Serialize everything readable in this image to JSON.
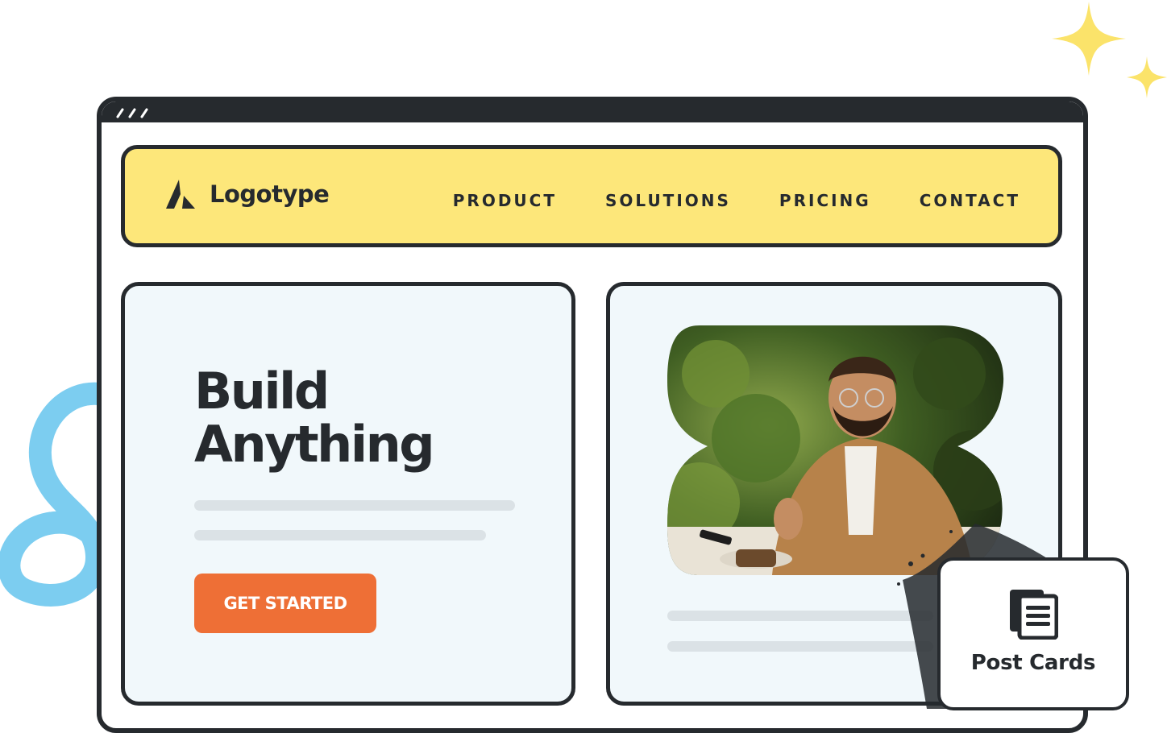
{
  "header": {
    "logo_text": "Logotype",
    "nav": [
      "PRODUCT",
      "SOLUTIONS",
      "PRICING",
      "CONTACT"
    ]
  },
  "hero": {
    "title_line1": "Build",
    "title_line2": "Anything",
    "cta_label": "GET STARTED"
  },
  "widget": {
    "label": "Post Cards",
    "icon": "document-stack-icon"
  },
  "colors": {
    "header_bg": "#fde77a",
    "cta": "#ee6f36",
    "card_bg": "#f1f8fb",
    "outline": "#262a2e",
    "accent_blue": "#7ccdf0",
    "sparkle": "#fbe36a"
  }
}
